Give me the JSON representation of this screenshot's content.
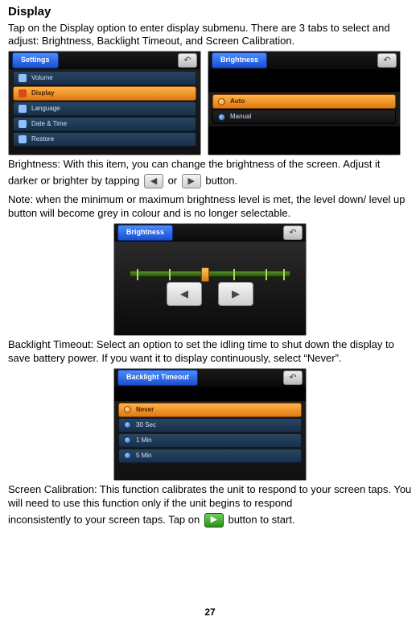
{
  "heading": "Display",
  "intro": "Tap on the Display option to enter display submenu. There are 3 tabs to select and adjust: Brightness, Backlight Timeout, and Screen Calibration.",
  "settings_screen": {
    "title": "Settings",
    "items": [
      "Volume",
      "Display",
      "Language",
      "Date & Time",
      "Restore"
    ],
    "selected": "Display"
  },
  "brightness_tabs_screen": {
    "title": "Brightness",
    "tabs": [
      "Auto",
      "Manual"
    ],
    "selected": "Auto"
  },
  "brightness_para_1": "Brightness: With this item, you can change the brightness of the screen. Adjust it ",
  "brightness_para_2a": "darker or brighter by tapping ",
  "brightness_para_2b": " or ",
  "brightness_para_2c": " button.",
  "brightness_note": "Note: when the minimum or maximum brightness level is met, the level down/ level up button will become grey in colour and is no longer selectable.",
  "brightness_slider_screen": {
    "title": "Brightness"
  },
  "backlight_para": "Backlight Timeout: Select an option to set the idling time to shut down the display to save battery power. If you want it to display continuously, select “Never”.",
  "backlight_screen": {
    "title": "Backlight Timeout",
    "options": [
      "Never",
      "30 Sec",
      "1 Min",
      "5 Min"
    ],
    "selected": "Never"
  },
  "calibration_para_a": "Screen Calibration: This function calibrates the unit to respond to your screen taps. You will need to use this function only if the unit begins to respond ",
  "calibration_para_b": "inconsistently to your screen taps. Tap on ",
  "calibration_para_c": " button to start.",
  "page_number": "27"
}
